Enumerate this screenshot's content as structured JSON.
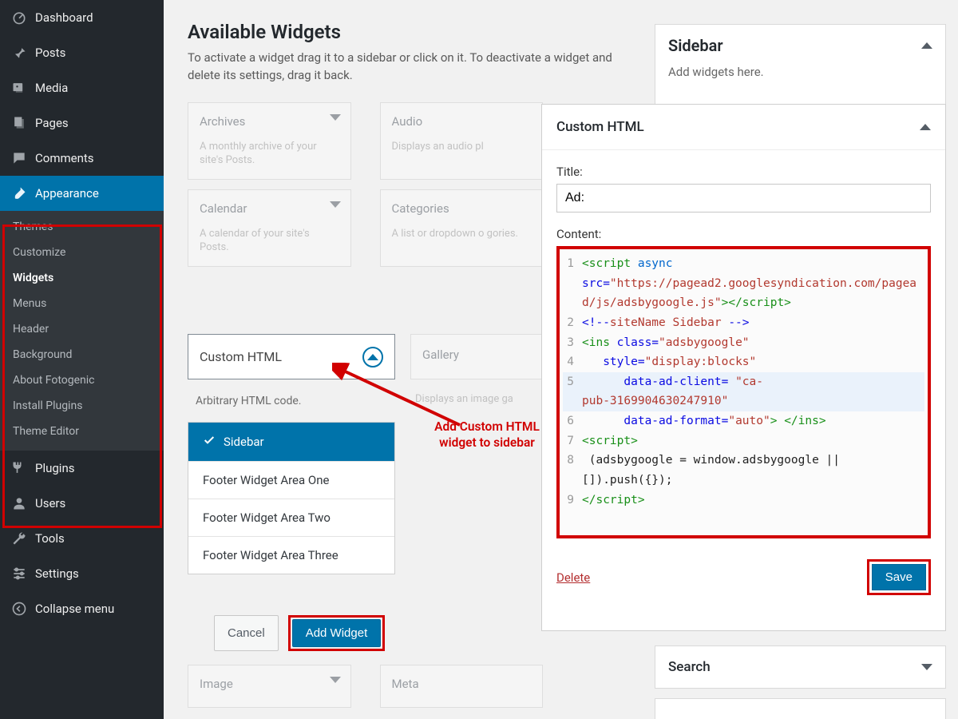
{
  "sidebar": {
    "items": [
      {
        "label": "Dashboard",
        "icon": "speedometer"
      },
      {
        "label": "Posts",
        "icon": "pin"
      },
      {
        "label": "Media",
        "icon": "media"
      },
      {
        "label": "Pages",
        "icon": "pages"
      },
      {
        "label": "Comments",
        "icon": "comment"
      },
      {
        "label": "Appearance",
        "icon": "brush",
        "active": true
      },
      {
        "label": "Plugins",
        "icon": "plug"
      },
      {
        "label": "Users",
        "icon": "user"
      },
      {
        "label": "Tools",
        "icon": "wrench"
      },
      {
        "label": "Settings",
        "icon": "sliders"
      },
      {
        "label": "Collapse menu",
        "icon": "collapse"
      }
    ],
    "submenu": {
      "parent": "Appearance",
      "items": [
        "Themes",
        "Customize",
        "Widgets",
        "Menus",
        "Header",
        "Background",
        "About Fotogenic",
        "Install Plugins",
        "Theme Editor"
      ],
      "current": "Widgets"
    }
  },
  "available": {
    "title": "Available Widgets",
    "desc": "To activate a widget drag it to a sidebar or click on it. To deactivate a widget and delete its settings, drag it back.",
    "cards": [
      {
        "title": "Archives",
        "desc": "A monthly archive of your site's Posts."
      },
      {
        "title": "Audio",
        "desc": "Displays an audio pl"
      },
      {
        "title": "Calendar",
        "desc": "A calendar of your site's Posts."
      },
      {
        "title": "Categories",
        "desc": "A list or dropdown o gories."
      }
    ],
    "gallery": {
      "title": "Gallery",
      "desc": "Displays an image ga"
    },
    "custom_html": {
      "title": "Custom HTML",
      "desc": "Arbitrary HTML code."
    },
    "faded": [
      {
        "title": "Image"
      },
      {
        "title": "Meta"
      }
    ]
  },
  "targets": {
    "items": [
      "Sidebar",
      "Footer Widget Area One",
      "Footer Widget Area Two",
      "Footer Widget Area Three"
    ],
    "selected": "Sidebar"
  },
  "buttons": {
    "cancel": "Cancel",
    "add": "Add Widget",
    "save": "Save",
    "delete": "Delete"
  },
  "callout": "Add Custom HTML widget to sidebar",
  "right": {
    "sidebar_panel": {
      "title": "Sidebar",
      "helper": "Add widgets here."
    },
    "custom_panel": {
      "title": "Custom HTML",
      "title_label": "Title:",
      "title_value": "Ad:",
      "content_label": "Content:"
    },
    "search_panel": {
      "title": "Search"
    }
  },
  "code": {
    "lines": [
      {
        "n": 1,
        "segs": [
          [
            "tg",
            "<script "
          ],
          [
            "kw",
            "async"
          ]
        ]
      },
      {
        "n": 0,
        "segs": [
          [
            "at",
            "src="
          ],
          [
            "vl",
            "\"https://pagead2.googlesyndication.com/pagead/js/adsbygoogle.js\""
          ],
          [
            "tg",
            "></script>"
          ]
        ]
      },
      {
        "n": 2,
        "segs": [
          [
            "cm",
            "<!--"
          ],
          [
            "cmtxt",
            "siteName Sidebar "
          ],
          [
            "cm",
            "-->"
          ]
        ]
      },
      {
        "n": 3,
        "segs": [
          [
            "tg",
            "<ins "
          ],
          [
            "at",
            "class="
          ],
          [
            "vl",
            "\"adsbygoogle\""
          ]
        ]
      },
      {
        "n": 4,
        "segs": [
          [
            "",
            "   "
          ],
          [
            "at",
            "style="
          ],
          [
            "vl",
            "\"display:blocks\""
          ]
        ]
      },
      {
        "n": 5,
        "hl": true,
        "segs": [
          [
            "",
            "      "
          ],
          [
            "at",
            "data-ad-client= "
          ],
          [
            "vl",
            "\"ca-"
          ]
        ]
      },
      {
        "n": 0,
        "hl": true,
        "segs": [
          [
            "vl",
            "pub-3169904630247910\""
          ]
        ]
      },
      {
        "n": 6,
        "segs": [
          [
            "",
            "      "
          ],
          [
            "at",
            "data-ad-format="
          ],
          [
            "vl",
            "\"auto\""
          ],
          [
            "tg",
            "> </ins>"
          ]
        ]
      },
      {
        "n": 7,
        "segs": [
          [
            "tg",
            "<script>"
          ]
        ]
      },
      {
        "n": 8,
        "segs": [
          [
            "",
            " (adsbygoogle = window.adsbygoogle || "
          ]
        ]
      },
      {
        "n": 0,
        "segs": [
          [
            "",
            "[]).push({});"
          ]
        ]
      },
      {
        "n": 9,
        "segs": [
          [
            "tg",
            "</script>"
          ]
        ]
      }
    ]
  }
}
